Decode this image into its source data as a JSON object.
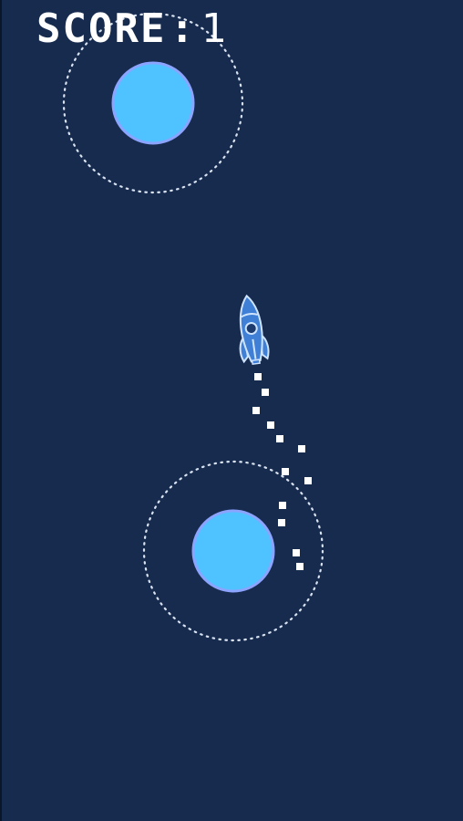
{
  "hud": {
    "score_label": "SCORE",
    "score_separator": ":",
    "score_value": "1"
  },
  "colors": {
    "background": "#172b4f",
    "planet_fill": "#4fc3ff",
    "planet_stroke": "#8aa4ff",
    "orbit_dots": "#d8e2f0",
    "rocket_body": "#3f7fd6",
    "rocket_outline": "#cfe4ff",
    "trail": "#ffffff"
  },
  "icons": {
    "rocket": "rocket-icon",
    "planet": "planet-icon"
  }
}
